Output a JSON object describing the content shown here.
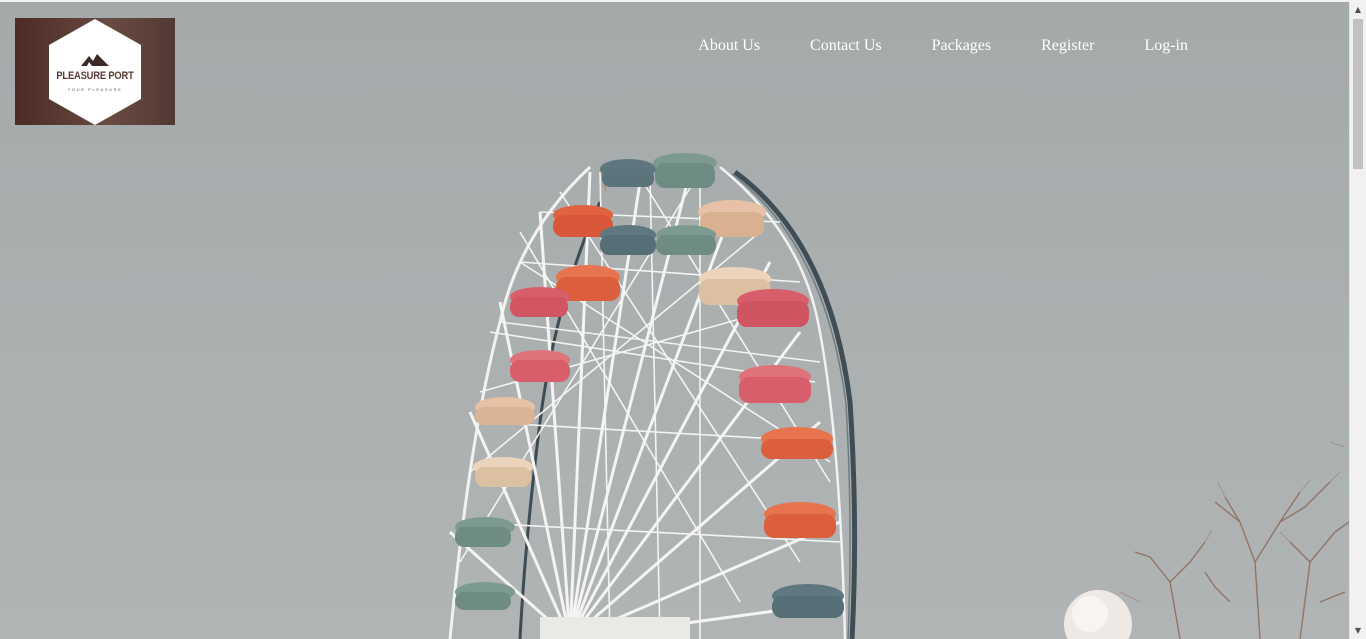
{
  "brand": {
    "name": "PLEASURE PORT",
    "tagline": "YOUR PLEASURE"
  },
  "nav": {
    "items": [
      {
        "label": "About Us"
      },
      {
        "label": "Contact Us"
      },
      {
        "label": "Packages"
      },
      {
        "label": "Register"
      },
      {
        "label": "Log-in"
      }
    ]
  },
  "hero": {
    "image": "ferris-wheel-photo",
    "sky_color": "#a8adae",
    "gondola_colors": [
      "#e2623f",
      "#d95e6b",
      "#e6c1a6",
      "#7d9a91",
      "#5f7880"
    ]
  },
  "scrollbar": {
    "up_icon": "arrow-up-icon",
    "down_icon": "arrow-down-icon"
  }
}
